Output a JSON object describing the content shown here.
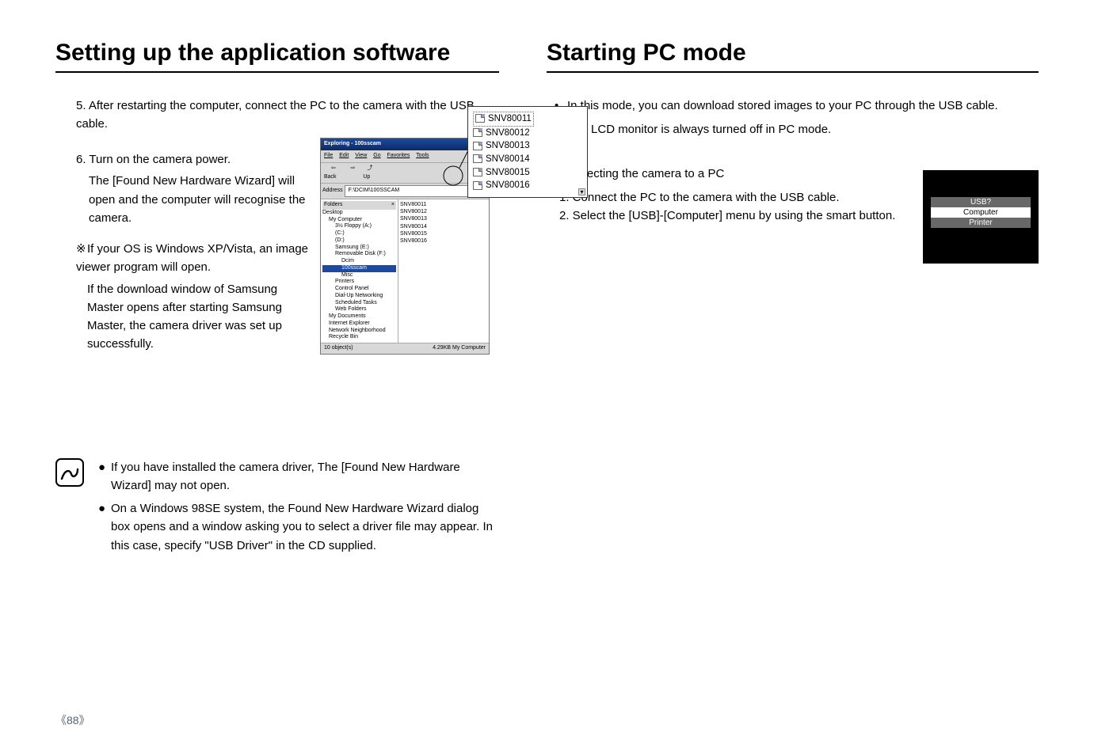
{
  "left": {
    "heading": "Setting up the application software",
    "step5": "5. After restarting the computer, connect the PC to the camera with the USB cable.",
    "step6_line1": "6. Turn on the camera power.",
    "step6_line2": "The [Found New Hardware Wizard] will open and the computer will recognise the camera.",
    "note_symbol": "※",
    "note_line1": "If your OS is Windows XP/Vista, an image viewer program will open.",
    "note_line2": "If the download window of Samsung Master opens after starting Samsung Master, the camera driver was set up successfully.",
    "info": {
      "item1": "If you have installed the camera driver, The [Found New Hardware Wizard] may not open.",
      "item2": "On a Windows 98SE system, the Found New Hardware Wizard dialog box opens and a window asking you to select a driver file may appear. In this case, specify \"USB Driver\" in the CD supplied."
    },
    "explorer": {
      "title": "Exploring - 100sscam",
      "menu": {
        "file": "File",
        "edit": "Edit",
        "view": "View",
        "go": "Go",
        "fav": "Favorites",
        "tool": "Tools"
      },
      "tool": {
        "back": "Back",
        "up": "Up"
      },
      "address_label": "Address",
      "address_value": "F:\\DCIM\\100SSCAM",
      "folders_label": "Folders",
      "tree": {
        "desktop": "Desktop",
        "mycomp": "My Computer",
        "floppy": "3½ Floppy (A:)",
        "c": "(C:)",
        "d": "(D:)",
        "samsung": "Samsung (E:)",
        "remov": "Removable Disk (F:)",
        "dcim": "Dcim",
        "sscam": "100sscam",
        "misc": "Misc",
        "printers": "Printers",
        "cpanel": "Control Panel",
        "dialup": "Dial-Up Networking",
        "sched": "Scheduled Tasks",
        "webf": "Web Folders",
        "mydocs": "My Documents",
        "ie": "Internet Explorer",
        "netn": "Network Neighborhood",
        "recycle": "Recycle Bin"
      },
      "files": [
        "SNV80011",
        "SNV80012",
        "SNV80013",
        "SNV80014",
        "SNV80015",
        "SNV80016"
      ],
      "status_left": "10 object(s)",
      "status_right": "4.29KB   My Computer"
    },
    "callout": [
      "SNV80011",
      "SNV80012",
      "SNV80013",
      "SNV80014",
      "SNV80015",
      "SNV80016"
    ]
  },
  "right": {
    "heading": "Starting PC mode",
    "bullets": {
      "b1": "In this mode, you can download stored images to your PC through the USB cable.",
      "b2": "The LCD monitor is always turned off in PC mode."
    },
    "conn_head": "Connecting the camera to a PC",
    "conn_step1": "1. Connect the PC to the camera with the USB cable.",
    "conn_step2": "2. Select the [USB]-[Computer] menu by using the smart button.",
    "lcd": {
      "usb": "USB?",
      "computer": "Computer",
      "printer": "Printer"
    }
  },
  "page_number": "88"
}
